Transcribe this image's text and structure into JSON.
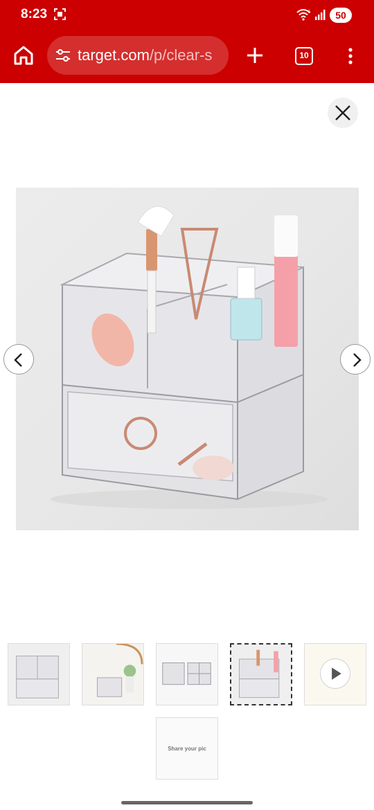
{
  "status_bar": {
    "time": "8:23",
    "battery": "50"
  },
  "browser": {
    "url_main": "target.com",
    "url_rest": "/p/clear-s",
    "tab_count": "10",
    "theme_color": "#cc0000"
  },
  "icons": {
    "home": "home-icon",
    "url_settings": "tune-icon",
    "new_tab": "plus-icon",
    "menu": "more-vertical-icon",
    "close": "close-icon",
    "prev": "chevron-left-icon",
    "next": "chevron-right-icon",
    "play": "play-icon"
  },
  "gallery": {
    "selected_index": 4,
    "thumbnail_count": 5,
    "share_label": "Share your pic"
  }
}
